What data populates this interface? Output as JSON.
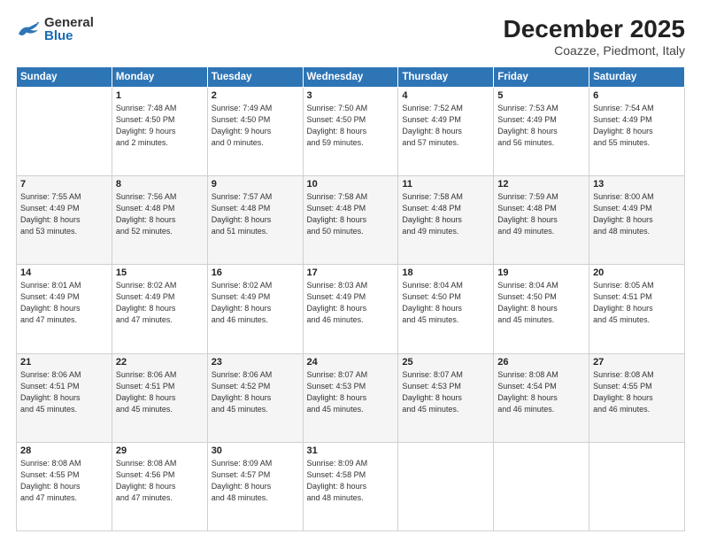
{
  "header": {
    "logo_line1": "General",
    "logo_line2": "Blue",
    "month": "December 2025",
    "location": "Coazze, Piedmont, Italy"
  },
  "days_of_week": [
    "Sunday",
    "Monday",
    "Tuesday",
    "Wednesday",
    "Thursday",
    "Friday",
    "Saturday"
  ],
  "weeks": [
    [
      {
        "day": "",
        "info": ""
      },
      {
        "day": "1",
        "info": "Sunrise: 7:48 AM\nSunset: 4:50 PM\nDaylight: 9 hours\nand 2 minutes."
      },
      {
        "day": "2",
        "info": "Sunrise: 7:49 AM\nSunset: 4:50 PM\nDaylight: 9 hours\nand 0 minutes."
      },
      {
        "day": "3",
        "info": "Sunrise: 7:50 AM\nSunset: 4:50 PM\nDaylight: 8 hours\nand 59 minutes."
      },
      {
        "day": "4",
        "info": "Sunrise: 7:52 AM\nSunset: 4:49 PM\nDaylight: 8 hours\nand 57 minutes."
      },
      {
        "day": "5",
        "info": "Sunrise: 7:53 AM\nSunset: 4:49 PM\nDaylight: 8 hours\nand 56 minutes."
      },
      {
        "day": "6",
        "info": "Sunrise: 7:54 AM\nSunset: 4:49 PM\nDaylight: 8 hours\nand 55 minutes."
      }
    ],
    [
      {
        "day": "7",
        "info": "Sunrise: 7:55 AM\nSunset: 4:49 PM\nDaylight: 8 hours\nand 53 minutes."
      },
      {
        "day": "8",
        "info": "Sunrise: 7:56 AM\nSunset: 4:48 PM\nDaylight: 8 hours\nand 52 minutes."
      },
      {
        "day": "9",
        "info": "Sunrise: 7:57 AM\nSunset: 4:48 PM\nDaylight: 8 hours\nand 51 minutes."
      },
      {
        "day": "10",
        "info": "Sunrise: 7:58 AM\nSunset: 4:48 PM\nDaylight: 8 hours\nand 50 minutes."
      },
      {
        "day": "11",
        "info": "Sunrise: 7:58 AM\nSunset: 4:48 PM\nDaylight: 8 hours\nand 49 minutes."
      },
      {
        "day": "12",
        "info": "Sunrise: 7:59 AM\nSunset: 4:48 PM\nDaylight: 8 hours\nand 49 minutes."
      },
      {
        "day": "13",
        "info": "Sunrise: 8:00 AM\nSunset: 4:49 PM\nDaylight: 8 hours\nand 48 minutes."
      }
    ],
    [
      {
        "day": "14",
        "info": "Sunrise: 8:01 AM\nSunset: 4:49 PM\nDaylight: 8 hours\nand 47 minutes."
      },
      {
        "day": "15",
        "info": "Sunrise: 8:02 AM\nSunset: 4:49 PM\nDaylight: 8 hours\nand 47 minutes."
      },
      {
        "day": "16",
        "info": "Sunrise: 8:02 AM\nSunset: 4:49 PM\nDaylight: 8 hours\nand 46 minutes."
      },
      {
        "day": "17",
        "info": "Sunrise: 8:03 AM\nSunset: 4:49 PM\nDaylight: 8 hours\nand 46 minutes."
      },
      {
        "day": "18",
        "info": "Sunrise: 8:04 AM\nSunset: 4:50 PM\nDaylight: 8 hours\nand 45 minutes."
      },
      {
        "day": "19",
        "info": "Sunrise: 8:04 AM\nSunset: 4:50 PM\nDaylight: 8 hours\nand 45 minutes."
      },
      {
        "day": "20",
        "info": "Sunrise: 8:05 AM\nSunset: 4:51 PM\nDaylight: 8 hours\nand 45 minutes."
      }
    ],
    [
      {
        "day": "21",
        "info": "Sunrise: 8:06 AM\nSunset: 4:51 PM\nDaylight: 8 hours\nand 45 minutes."
      },
      {
        "day": "22",
        "info": "Sunrise: 8:06 AM\nSunset: 4:51 PM\nDaylight: 8 hours\nand 45 minutes."
      },
      {
        "day": "23",
        "info": "Sunrise: 8:06 AM\nSunset: 4:52 PM\nDaylight: 8 hours\nand 45 minutes."
      },
      {
        "day": "24",
        "info": "Sunrise: 8:07 AM\nSunset: 4:53 PM\nDaylight: 8 hours\nand 45 minutes."
      },
      {
        "day": "25",
        "info": "Sunrise: 8:07 AM\nSunset: 4:53 PM\nDaylight: 8 hours\nand 45 minutes."
      },
      {
        "day": "26",
        "info": "Sunrise: 8:08 AM\nSunset: 4:54 PM\nDaylight: 8 hours\nand 46 minutes."
      },
      {
        "day": "27",
        "info": "Sunrise: 8:08 AM\nSunset: 4:55 PM\nDaylight: 8 hours\nand 46 minutes."
      }
    ],
    [
      {
        "day": "28",
        "info": "Sunrise: 8:08 AM\nSunset: 4:55 PM\nDaylight: 8 hours\nand 47 minutes."
      },
      {
        "day": "29",
        "info": "Sunrise: 8:08 AM\nSunset: 4:56 PM\nDaylight: 8 hours\nand 47 minutes."
      },
      {
        "day": "30",
        "info": "Sunrise: 8:09 AM\nSunset: 4:57 PM\nDaylight: 8 hours\nand 48 minutes."
      },
      {
        "day": "31",
        "info": "Sunrise: 8:09 AM\nSunset: 4:58 PM\nDaylight: 8 hours\nand 48 minutes."
      },
      {
        "day": "",
        "info": ""
      },
      {
        "day": "",
        "info": ""
      },
      {
        "day": "",
        "info": ""
      }
    ]
  ]
}
